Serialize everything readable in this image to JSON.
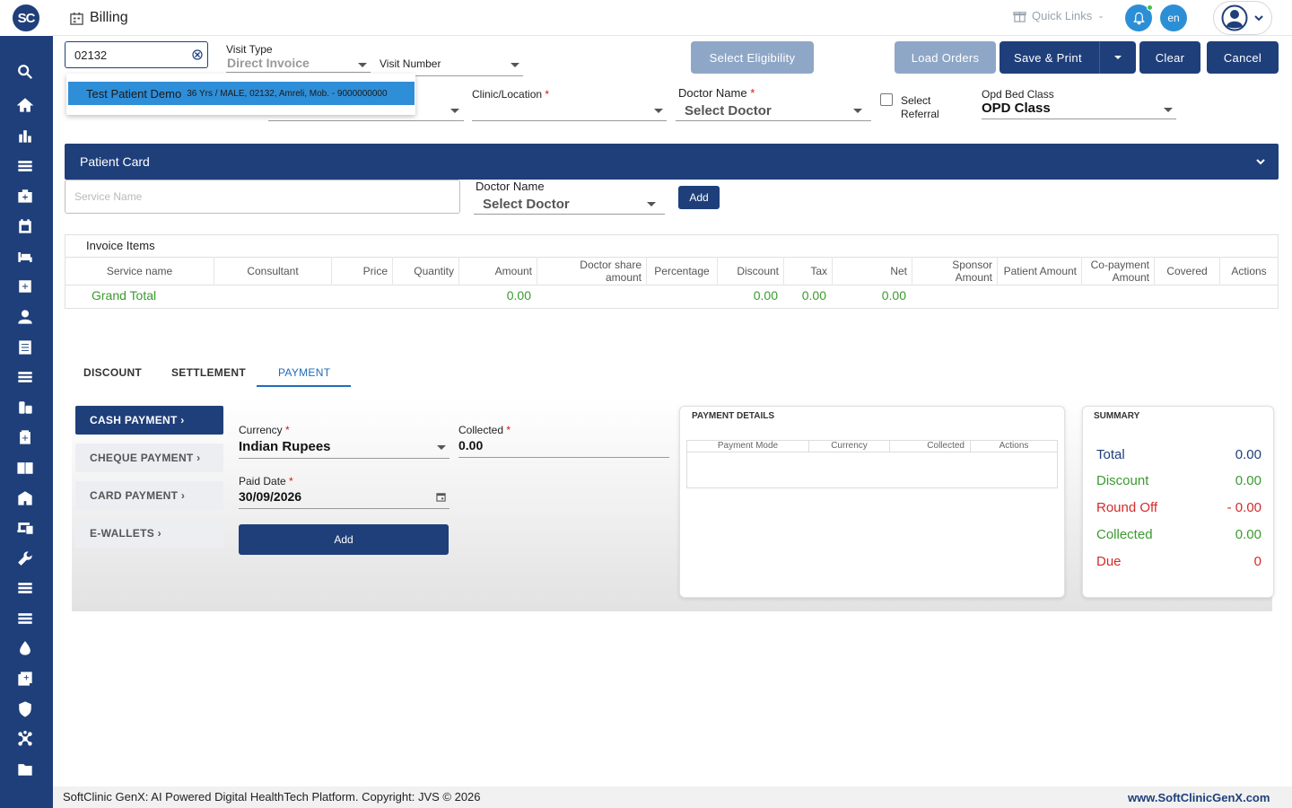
{
  "app": {
    "logo_text": "SC",
    "page_title": "Billing"
  },
  "colors": {
    "brand": "#1f3f7a",
    "accent": "#2c8fd6",
    "green": "#3b9a2e",
    "red": "#d42a2a",
    "button_light": "#8fa7c7"
  },
  "topbar": {
    "quick_links": "Quick Links",
    "lang": "en"
  },
  "sidebar": {
    "icons": [
      "search-icon",
      "home-icon",
      "chart-icon",
      "menu-icon",
      "medical-bag-icon",
      "calendar-icon",
      "bed-icon",
      "plus-box-icon",
      "person-icon",
      "list-doc-icon",
      "menu-icon-2",
      "pharmacy-icon",
      "plus-square-icon",
      "book-icon",
      "hospital-icon",
      "devices-icon",
      "wrench-icon",
      "menu-icon-3",
      "menu-icon-4",
      "drop-icon",
      "add-box-icon",
      "shield-icon",
      "network-icon",
      "folder-icon"
    ]
  },
  "form": {
    "search_value": "02132",
    "visit_type_label": "Visit Type",
    "visit_type_value": "Direct Invoice",
    "visit_number_label": "Visit Number",
    "clinic_label": "Clinic/Location",
    "doctor_label": "Doctor Name",
    "doctor_value": "Select Doctor",
    "select_referral_label": "Select Referral",
    "opd_bed_label": "Opd Bed Class",
    "opd_bed_value": "OPD Class"
  },
  "patient_dropdown": {
    "name": "Test Patient Demo",
    "detail": "36 Yrs / MALE, 02132, Amreli, Mob. - 9000000000"
  },
  "buttons": {
    "select_eligibility": "Select Eligibility",
    "load_orders": "Load Orders",
    "save_print": "Save & Print",
    "clear": "Clear",
    "cancel": "Cancel"
  },
  "patient_card": {
    "title": "Patient Card",
    "service_placeholder": "Service Name",
    "doctor_label": "Doctor Name",
    "doctor_value": "Select Doctor",
    "add_label": "Add"
  },
  "invoice": {
    "title": "Invoice Items",
    "columns": [
      "Service name",
      "Consultant",
      "Price",
      "Quantity",
      "Amount",
      "Doctor share amount",
      "Percentage",
      "Discount",
      "Tax",
      "Net",
      "Sponsor Amount",
      "Patient Amount",
      "Co-payment Amount",
      "Covered",
      "Actions"
    ],
    "grand_total_label": "Grand Total",
    "totals": {
      "amount": "0.00",
      "discount": "0.00",
      "tax": "0.00",
      "net": "0.00"
    }
  },
  "tabs": [
    "DISCOUNT",
    "SETTLEMENT",
    "PAYMENT"
  ],
  "payment": {
    "options": [
      "CASH PAYMENT ›",
      "CHEQUE PAYMENT ›",
      "CARD PAYMENT ›",
      "E-WALLETS ›"
    ],
    "currency_label": "Currency",
    "currency_value": "Indian Rupees",
    "collected_label": "Collected",
    "collected_value": "0.00",
    "paid_date_label": "Paid Date",
    "paid_date_value": "30/09/2026",
    "add_label": "Add"
  },
  "payment_details": {
    "title": "PAYMENT DETAILS",
    "columns": [
      "Payment Mode",
      "Currency",
      "Collected",
      "Actions"
    ]
  },
  "summary": {
    "title": "SUMMARY",
    "rows": [
      {
        "label": "Total",
        "value": "0.00"
      },
      {
        "label": "Discount",
        "value": "0.00"
      },
      {
        "label": "Round Off",
        "value": "- 0.00"
      },
      {
        "label": "Collected",
        "value": "0.00"
      },
      {
        "label": "Due",
        "value": "0"
      }
    ]
  },
  "footer": {
    "left": "SoftClinic GenX: AI Powered Digital HealthTech Platform. Copyright: JVS © 2026",
    "right": "www.SoftClinicGenX.com"
  }
}
